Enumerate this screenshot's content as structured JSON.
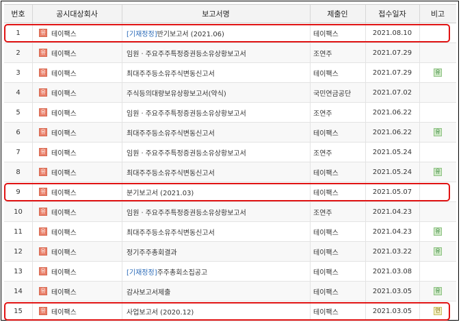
{
  "headers": {
    "num": "번호",
    "company": "공시대상회사",
    "report": "보고서명",
    "filer": "제출인",
    "date": "접수일자",
    "note": "비고"
  },
  "company_badge": "유",
  "rows": [
    {
      "num": "1",
      "company": "테이팩스",
      "report_prefix": "[기재정정]",
      "report": "반기보고서 (2021.06)",
      "filer": "테이팩스",
      "date": "2021.08.10",
      "note": "",
      "highlight": true
    },
    {
      "num": "2",
      "company": "테이팩스",
      "report_prefix": "",
      "report": "임원ㆍ주요주주특정증권등소유상황보고서",
      "filer": "조연주",
      "date": "2021.07.29",
      "note": ""
    },
    {
      "num": "3",
      "company": "테이팩스",
      "report_prefix": "",
      "report": "최대주주등소유주식변동신고서",
      "filer": "테이팩스",
      "date": "2021.07.29",
      "note": "유"
    },
    {
      "num": "4",
      "company": "테이팩스",
      "report_prefix": "",
      "report": "주식등의대량보유상황보고서(약식)",
      "filer": "국민연금공단",
      "date": "2021.07.02",
      "note": ""
    },
    {
      "num": "5",
      "company": "테이팩스",
      "report_prefix": "",
      "report": "임원ㆍ주요주주특정증권등소유상황보고서",
      "filer": "조연주",
      "date": "2021.06.22",
      "note": ""
    },
    {
      "num": "6",
      "company": "테이팩스",
      "report_prefix": "",
      "report": "최대주주등소유주식변동신고서",
      "filer": "테이팩스",
      "date": "2021.06.22",
      "note": "유"
    },
    {
      "num": "7",
      "company": "테이팩스",
      "report_prefix": "",
      "report": "임원ㆍ주요주주특정증권등소유상황보고서",
      "filer": "조연주",
      "date": "2021.05.24",
      "note": ""
    },
    {
      "num": "8",
      "company": "테이팩스",
      "report_prefix": "",
      "report": "최대주주등소유주식변동신고서",
      "filer": "테이팩스",
      "date": "2021.05.24",
      "note": "유"
    },
    {
      "num": "9",
      "company": "테이팩스",
      "report_prefix": "",
      "report": "분기보고서 (2021.03)",
      "filer": "테이팩스",
      "date": "2021.05.07",
      "note": "",
      "highlight": true
    },
    {
      "num": "10",
      "company": "테이팩스",
      "report_prefix": "",
      "report": "임원ㆍ주요주주특정증권등소유상황보고서",
      "filer": "조연주",
      "date": "2021.04.23",
      "note": ""
    },
    {
      "num": "11",
      "company": "테이팩스",
      "report_prefix": "",
      "report": "최대주주등소유주식변동신고서",
      "filer": "테이팩스",
      "date": "2021.04.23",
      "note": "유"
    },
    {
      "num": "12",
      "company": "테이팩스",
      "report_prefix": "",
      "report": "정기주주총회결과",
      "filer": "테이팩스",
      "date": "2021.03.22",
      "note": "유"
    },
    {
      "num": "13",
      "company": "테이팩스",
      "report_prefix": "[기재정정]",
      "report": "주주총회소집공고",
      "filer": "테이팩스",
      "date": "2021.03.08",
      "note": ""
    },
    {
      "num": "14",
      "company": "테이팩스",
      "report_prefix": "",
      "report": "감사보고서제출",
      "filer": "테이팩스",
      "date": "2021.03.05",
      "note": "유"
    },
    {
      "num": "15",
      "company": "테이팩스",
      "report_prefix": "",
      "report": "사업보고서 (2020.12)",
      "filer": "테이팩스",
      "date": "2021.03.05",
      "note": "연",
      "highlight": true
    }
  ],
  "colors": {
    "highlight": "#e01212",
    "company_badge": "#e9806a",
    "note_badge": "#cfe9c7",
    "link": "#2a6ab8"
  }
}
